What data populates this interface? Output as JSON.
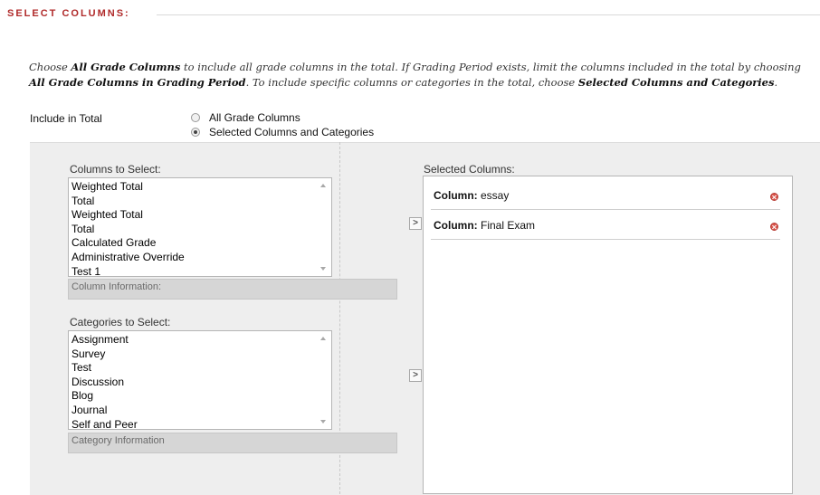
{
  "section": {
    "title": "SELECT COLUMNS:"
  },
  "instructions": {
    "t1": "Choose ",
    "b1": "All Grade Columns",
    "t2": " to include all grade columns in the total. If Grading Period exists, limit the columns included in the total by choosing ",
    "b2": "All Grade Columns in Grading Period",
    "t3": ". To include specific columns or categories in the total, choose ",
    "b3": "Selected Columns and Categories",
    "t4": "."
  },
  "include": {
    "label": "Include in Total",
    "options": [
      {
        "label": "All Grade Columns",
        "checked": false
      },
      {
        "label": "Selected Columns and Categories",
        "checked": true
      }
    ]
  },
  "columns": {
    "label": "Columns to Select:",
    "items": [
      "Weighted Total",
      "Total",
      "Weighted Total",
      "Total",
      "Calculated Grade",
      "Administrative Override",
      "Test 1"
    ],
    "info": "Column Information:"
  },
  "categories": {
    "label": "Categories to Select:",
    "items": [
      "Assignment",
      "Survey",
      "Test",
      "Discussion",
      "Blog",
      "Journal",
      "Self and Peer"
    ],
    "info": "Category Information"
  },
  "move_button_glyph": ">",
  "selected": {
    "label": "Selected Columns:",
    "items": [
      {
        "prefix": "Column:",
        "value": "essay"
      },
      {
        "prefix": "Column:",
        "value": "Final Exam"
      }
    ]
  },
  "colors": {
    "section_title": "#b02a2a",
    "panel_bg": "#eeeeee",
    "remove_icon": "#d9534a"
  },
  "icons": {
    "remove": "remove-x-circle-icon",
    "move": "chevron-right-icon",
    "scroll": "scroll-arrow-icon"
  }
}
